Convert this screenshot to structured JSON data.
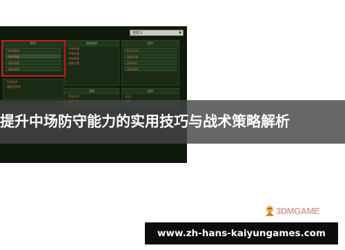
{
  "title": "提升中场防守能力的实用技巧与战术策略解析",
  "url": "www.zh-hans-kaiyungames.com",
  "watermark": {
    "brand": "3DMGAME",
    "icon": "3dm-logo-icon"
  },
  "game_ui": {
    "dropdown": {
      "value": "自定义"
    },
    "panels": [
      {
        "header": "防守",
        "buttons": [
          "防线高度",
          "防守宽度",
          "逼抢强度",
          "逼抢选择"
        ]
      },
      {
        "header": "进攻战术",
        "buttons": [
          "传球节奏",
          "传球长度",
          "进攻宽度",
          "前插位置"
        ]
      },
      {
        "header": "防守",
        "buttons": [
          "盯人方式",
          "逼抢区域",
          "防守站位",
          "越位陷阱"
        ]
      }
    ],
    "lower_left": [
      "盯防战术",
      "逼抢型防线"
    ],
    "lower_mid_header": "进攻",
    "lower_mid": [
      "传球方向",
      "直塞传球"
    ],
    "lower_right_header": "战术",
    "lower_right": [
      "反击",
      "组织"
    ]
  },
  "colors": {
    "highlight_box": "#d11a1a",
    "band": "#464646",
    "url_bar": "#0c0c0c"
  }
}
